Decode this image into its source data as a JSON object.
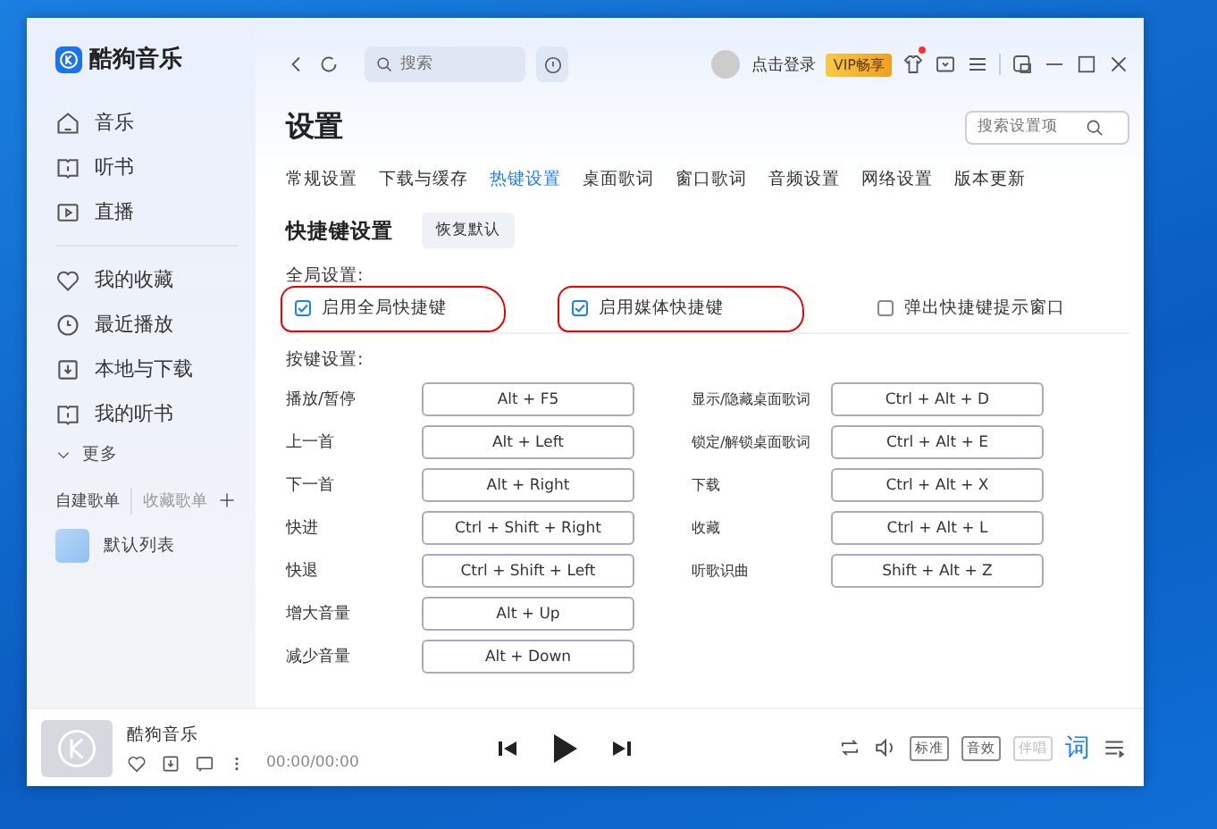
{
  "window": {
    "app_name": "酷狗音乐"
  },
  "sidebar": {
    "nav": [
      {
        "label": "音乐"
      },
      {
        "label": "听书"
      },
      {
        "label": "直播"
      }
    ],
    "library": [
      {
        "label": "我的收藏"
      },
      {
        "label": "最近播放"
      },
      {
        "label": "本地与下载"
      },
      {
        "label": "我的听书"
      }
    ],
    "more": "更多",
    "playlist_tabs": [
      {
        "label": "自建歌单",
        "selected": true
      },
      {
        "label": "收藏歌单",
        "selected": false
      }
    ],
    "playlists": [
      {
        "name": "默认列表"
      }
    ]
  },
  "topbar": {
    "search": {
      "placeholder": "搜索"
    },
    "login": "点击登录",
    "vip": "VIP畅享"
  },
  "settings": {
    "title": "设置",
    "search": {
      "placeholder": "搜索设置项"
    },
    "tabs": [
      {
        "label": "常规设置",
        "selected": false
      },
      {
        "label": "下载与缓存",
        "selected": false
      },
      {
        "label": "热键设置",
        "selected": true
      },
      {
        "label": "桌面歌词",
        "selected": false
      },
      {
        "label": "窗口歌词",
        "selected": false
      },
      {
        "label": "音频设置",
        "selected": false
      },
      {
        "label": "网络设置",
        "selected": false
      },
      {
        "label": "版本更新",
        "selected": false
      }
    ],
    "section_title": "快捷键设置",
    "reset_button": "恢复默认",
    "global_label": "全局设置:",
    "options": [
      {
        "label": "启用全局快捷键",
        "checked": true,
        "annotated": true
      },
      {
        "label": "启用媒体快捷键",
        "checked": true,
        "annotated": true
      },
      {
        "label": "弹出快捷键提示窗口",
        "checked": false
      }
    ],
    "keys_label": "按键设置:",
    "hotkey_columns": [
      [
        {
          "action": "播放/暂停",
          "keys": "Alt + F5"
        },
        {
          "action": "上一首",
          "keys": "Alt + Left"
        },
        {
          "action": "下一首",
          "keys": "Alt + Right"
        },
        {
          "action": "快进",
          "keys": "Ctrl + Shift + Right"
        },
        {
          "action": "快退",
          "keys": "Ctrl + Shift + Left"
        },
        {
          "action": "增大音量",
          "keys": "Alt + Up"
        },
        {
          "action": "减少音量",
          "keys": "Alt + Down"
        }
      ],
      [
        {
          "action": "显示/隐藏桌面歌词",
          "keys": "Ctrl + Alt + D"
        },
        {
          "action": "锁定/解锁桌面歌词",
          "keys": "Ctrl + Alt + E"
        },
        {
          "action": "下载",
          "keys": "Ctrl + Alt + X"
        },
        {
          "action": "收藏",
          "keys": "Ctrl + Alt + L"
        },
        {
          "action": "听歌识曲",
          "keys": "Shift + Alt + Z"
        }
      ]
    ]
  },
  "player": {
    "song": "酷狗音乐",
    "time": "00:00/00:00",
    "badges": [
      {
        "label": "标准",
        "disabled": false
      },
      {
        "label": "音效",
        "disabled": false
      },
      {
        "label": "伴唱",
        "disabled": true
      }
    ],
    "lyrics_button": "词"
  }
}
